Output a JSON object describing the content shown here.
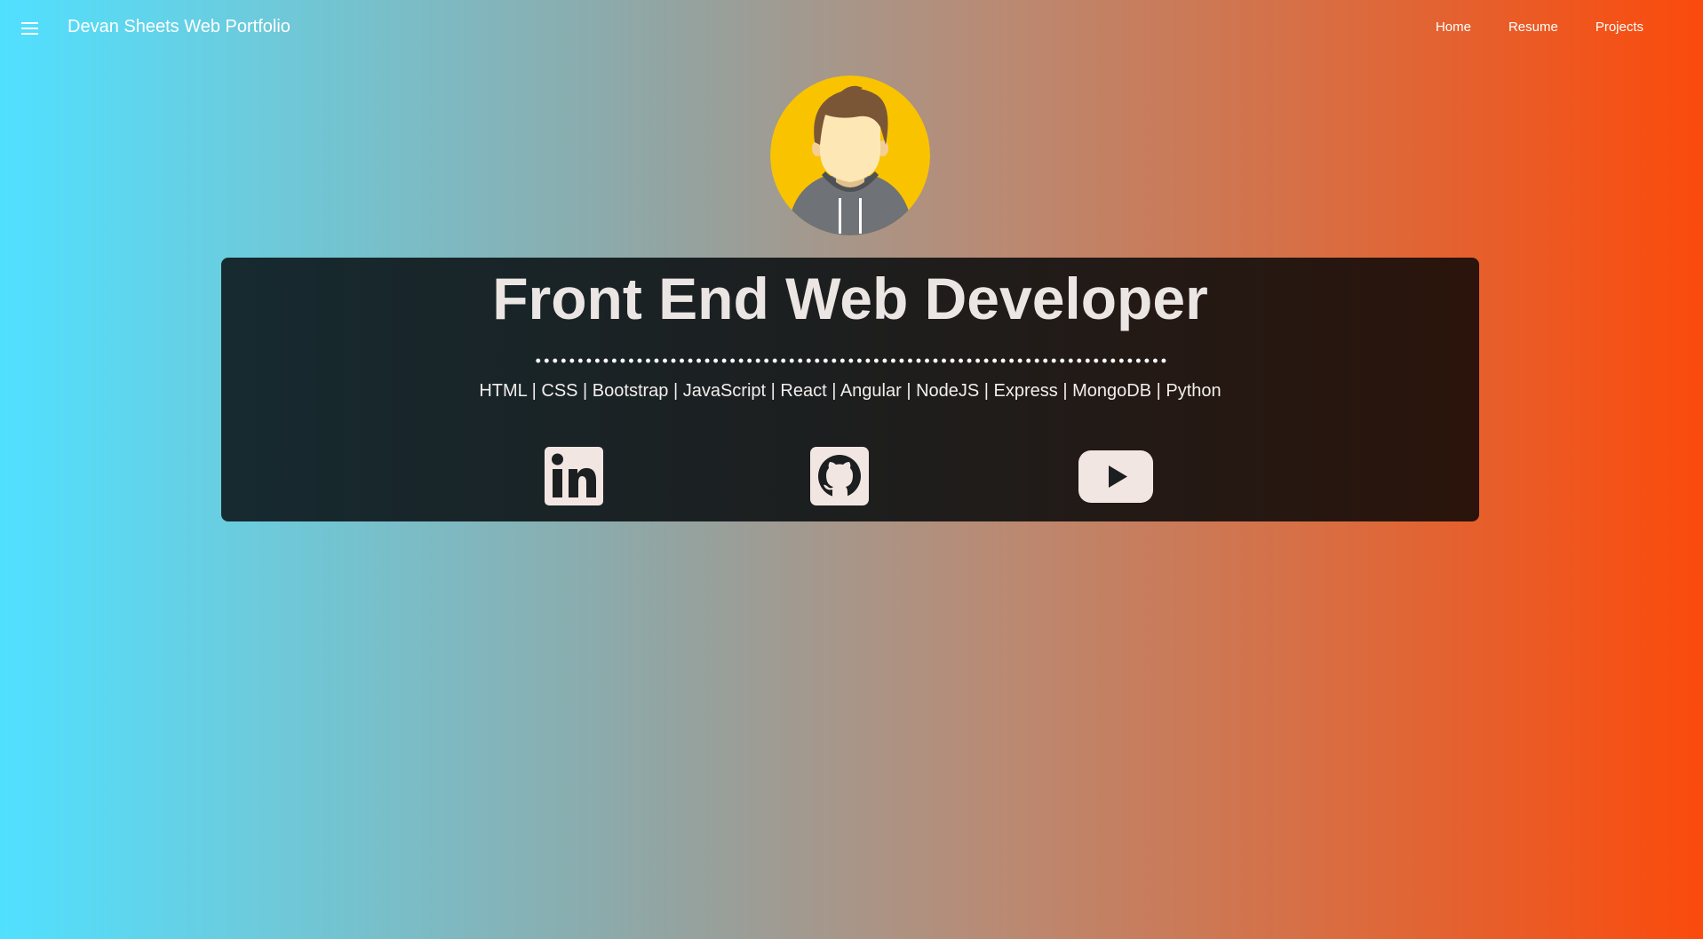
{
  "navbar": {
    "brand": "Devan Sheets Web Portfolio",
    "menu_icon": "hamburger-menu-icon",
    "links": [
      {
        "label": "Home"
      },
      {
        "label": "Resume"
      },
      {
        "label": "Projects"
      }
    ]
  },
  "hero": {
    "avatar_icon": "developer-avatar-icon",
    "title": "Front End Web Developer",
    "skills": "HTML | CSS | Bootstrap | JavaScript | React | Angular | NodeJS | Express | MongoDB | Python",
    "social": [
      {
        "icon": "linkedin-icon"
      },
      {
        "icon": "github-icon"
      },
      {
        "icon": "youtube-icon"
      }
    ]
  },
  "colors": {
    "gradient_left": "#50e0ff",
    "gradient_right": "#fb4a0c",
    "card_background": "#1c1f20",
    "avatar_background": "#f9c300",
    "icon_color": "#f2e6e3"
  }
}
